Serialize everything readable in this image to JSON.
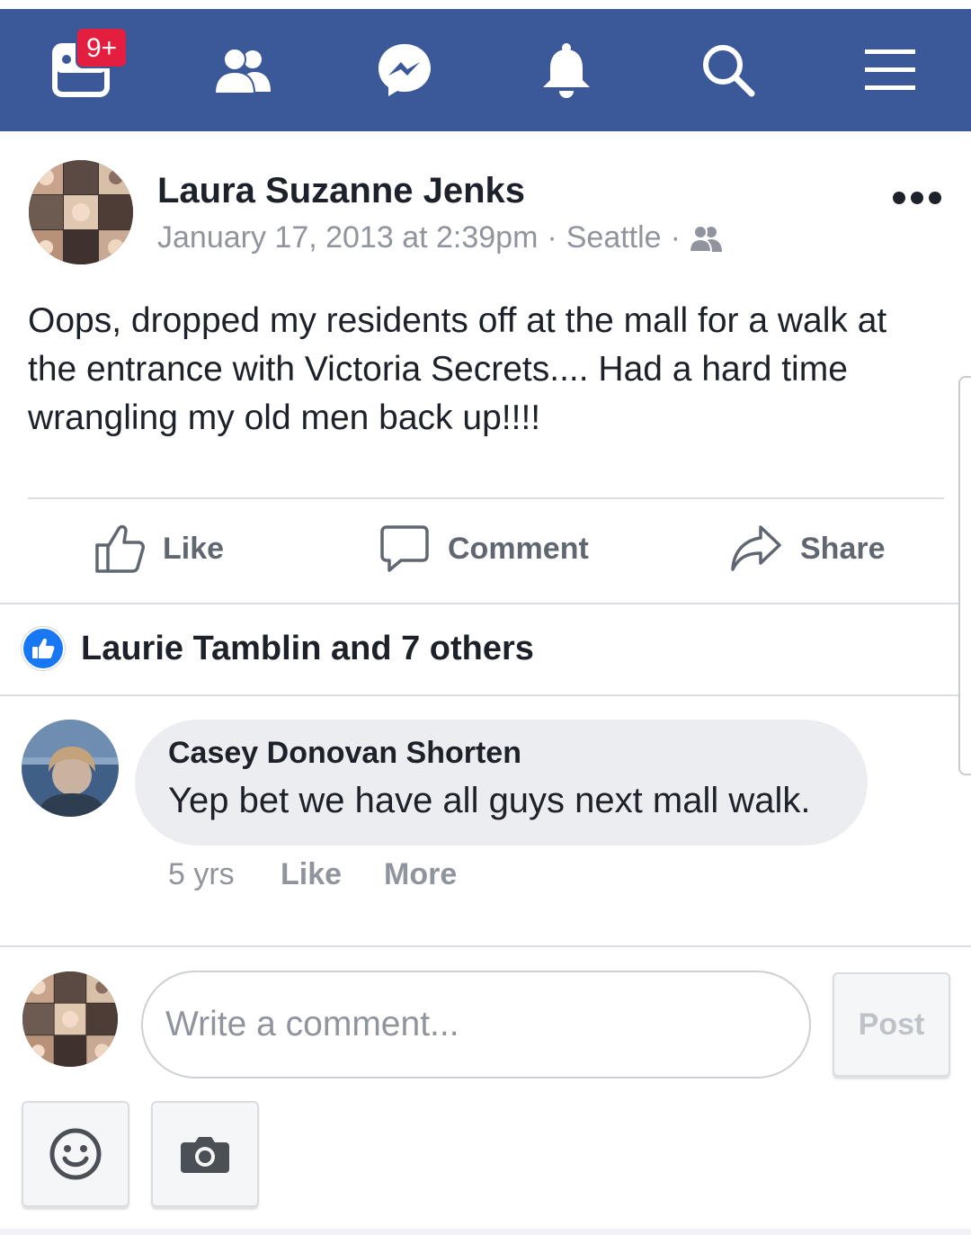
{
  "colors": {
    "nav_bg": "#3b5998",
    "badge_bg": "#e41e3f",
    "like_blue": "#1877f2",
    "secondary_text": "#90949c"
  },
  "nav": {
    "items": [
      {
        "name": "news-feed",
        "icon": "news-feed-icon",
        "badge": "9+"
      },
      {
        "name": "friends",
        "icon": "friends-icon"
      },
      {
        "name": "messenger",
        "icon": "messenger-icon"
      },
      {
        "name": "notifications",
        "icon": "bell-icon"
      },
      {
        "name": "search",
        "icon": "search-icon"
      },
      {
        "name": "menu",
        "icon": "hamburger-menu-icon"
      }
    ]
  },
  "post": {
    "author": "Laura Suzanne Jenks",
    "date": "January 17, 2013 at 2:39pm",
    "location": "Seattle",
    "audience_icon": "friends-audience-icon",
    "text": "Oops, dropped my residents off at the mall for a walk at the entrance with Victoria Secrets.... Had a hard time wrangling my old men back up!!!!",
    "actions": {
      "like": "Like",
      "comment": "Comment",
      "share": "Share"
    },
    "likes_summary": "Laurie Tamblin and 7 others"
  },
  "comments": [
    {
      "author": "Casey Donovan Shorten",
      "text": "Yep bet we have all guys next mall walk.",
      "time": "5 yrs",
      "like_label": "Like",
      "more_label": "More"
    }
  ],
  "composer": {
    "placeholder": "Write a comment...",
    "post_label": "Post",
    "emoji_icon": "smiley-icon",
    "camera_icon": "camera-icon"
  }
}
